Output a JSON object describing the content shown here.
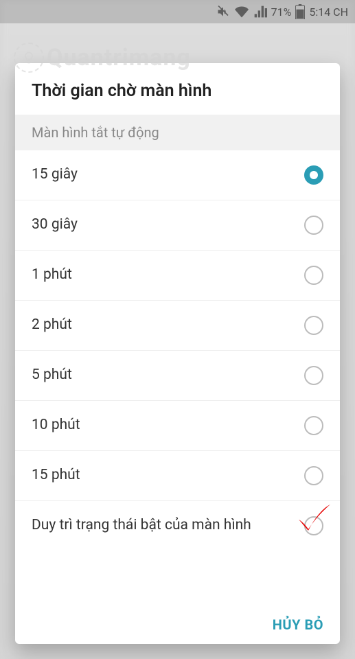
{
  "status_bar": {
    "battery_percent": "71%",
    "time": "5:14 CH"
  },
  "watermark": {
    "text": "Quantrimang"
  },
  "dialog": {
    "title": "Thời gian chờ màn hình",
    "section_header": "Màn hình tắt tự động",
    "cancel_label": "HỦY BỎ",
    "options": [
      {
        "label": "15 giây",
        "selected": true
      },
      {
        "label": "30 giây",
        "selected": false
      },
      {
        "label": "1 phút",
        "selected": false
      },
      {
        "label": "2 phút",
        "selected": false
      },
      {
        "label": "5 phút",
        "selected": false
      },
      {
        "label": "10 phút",
        "selected": false
      },
      {
        "label": "15 phút",
        "selected": false
      },
      {
        "label": "Duy trì trạng thái bật của màn hình",
        "selected": false,
        "annotated": true
      }
    ]
  }
}
